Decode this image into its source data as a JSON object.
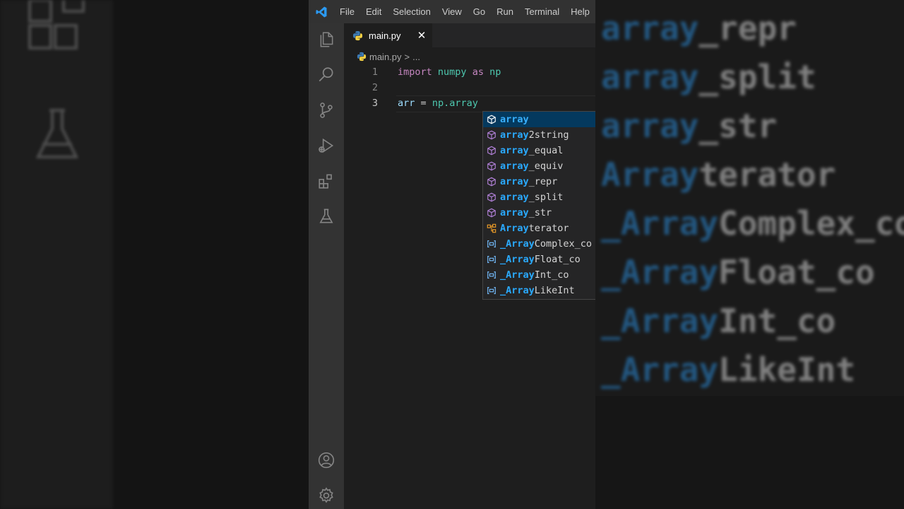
{
  "window": {
    "menu": [
      "File",
      "Edit",
      "Selection",
      "View",
      "Go",
      "Run",
      "Terminal",
      "Help"
    ]
  },
  "activity_bar": {
    "icons": [
      "explorer-icon",
      "search-icon",
      "source-control-icon",
      "run-debug-icon",
      "extensions-icon",
      "testing-icon",
      "account-icon",
      "settings-gear-icon"
    ]
  },
  "tab": {
    "label": "main.py",
    "close": "✕"
  },
  "breadcrumb": {
    "file": "main.py",
    "sep": ">",
    "rest": "..."
  },
  "code": {
    "lines": [
      {
        "num": "1"
      },
      {
        "num": "2"
      },
      {
        "num": "3"
      }
    ],
    "l1": {
      "kw1": "import",
      "mod": "numpy",
      "kw2": "as",
      "alias": "np"
    },
    "l3": {
      "var": "arr",
      "op": "=",
      "expr": "np.array"
    }
  },
  "suggest": {
    "items": [
      {
        "match": "array",
        "rest": "",
        "kind": "method"
      },
      {
        "match": "array",
        "rest": "2string",
        "kind": "method"
      },
      {
        "match": "array",
        "rest": "_equal",
        "kind": "method"
      },
      {
        "match": "array",
        "rest": "_equiv",
        "kind": "method"
      },
      {
        "match": "array",
        "rest": "_repr",
        "kind": "method"
      },
      {
        "match": "array",
        "rest": "_split",
        "kind": "method"
      },
      {
        "match": "array",
        "rest": "_str",
        "kind": "method"
      },
      {
        "match": "Array",
        "rest": "terator",
        "kind": "class"
      },
      {
        "match": "_Array",
        "rest": "Complex_co",
        "kind": "variable"
      },
      {
        "match": "_Array",
        "rest": "Float_co",
        "kind": "variable"
      },
      {
        "match": "_Array",
        "rest": "Int_co",
        "kind": "variable"
      },
      {
        "match": "_Array",
        "rest": "LikeInt",
        "kind": "variable"
      }
    ]
  },
  "background_right": {
    "items": [
      {
        "match": "array",
        "rest": "_repr"
      },
      {
        "match": "array",
        "rest": "_split"
      },
      {
        "match": "array",
        "rest": "_str"
      },
      {
        "match": "Array",
        "rest": "terator"
      },
      {
        "match": "_Array",
        "rest": "Complex_co"
      },
      {
        "match": "_Array",
        "rest": "Float_co"
      },
      {
        "match": "_Array",
        "rest": "Int_co"
      },
      {
        "match": "_Array",
        "rest": "LikeInt"
      }
    ]
  },
  "colors": {
    "accent": "#007acc",
    "selection": "#04395e",
    "match": "#2aaaff",
    "method_icon": "#b180d7",
    "class_icon": "#ee9d28",
    "variable_icon": "#75beff"
  }
}
